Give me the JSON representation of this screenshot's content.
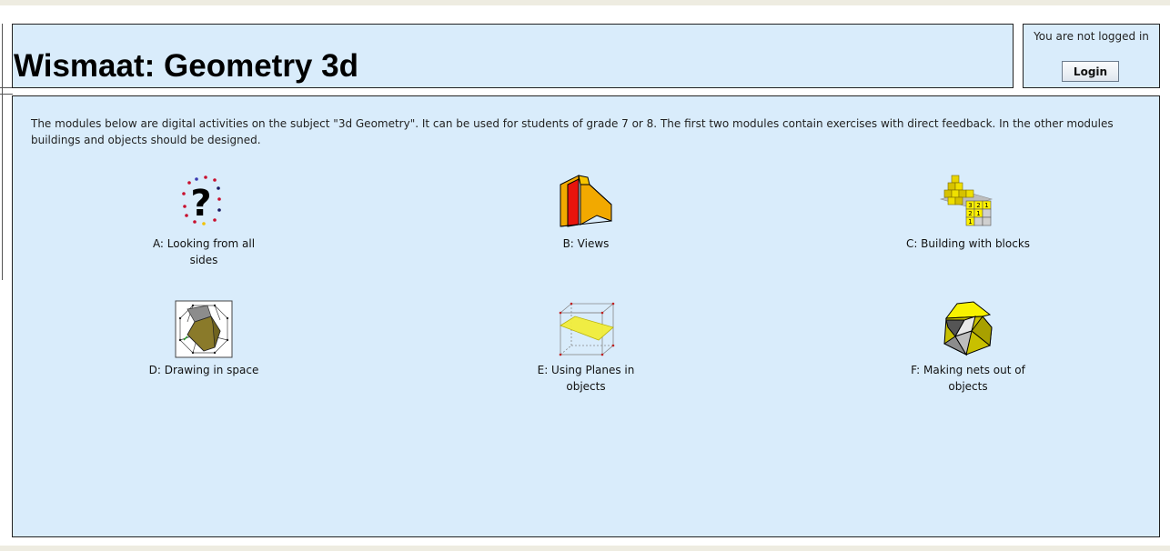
{
  "header": {
    "title": "Wismaat: Geometry 3d"
  },
  "login": {
    "status": "You are not logged in",
    "button_label": "Login"
  },
  "intro": "The modules below are digital activities on the subject \"3d Geometry\". It can be used for students of grade 7 or 8.  The first two modules contain exercises with direct feedback. In the other modules buildings and objects should be designed.",
  "modules": [
    {
      "label": "A: Looking from all sides",
      "icon": "question-mark-icon"
    },
    {
      "label": "B: Views",
      "icon": "red-yellow-block-icon"
    },
    {
      "label": "C: Building with blocks",
      "icon": "block-staircase-icon"
    },
    {
      "label": "D: Drawing in space",
      "icon": "polyhedron-drawing-icon"
    },
    {
      "label": "E: Using Planes in objects",
      "icon": "cube-plane-icon"
    },
    {
      "label": "F: Making nets out of objects",
      "icon": "folded-net-icon"
    }
  ]
}
